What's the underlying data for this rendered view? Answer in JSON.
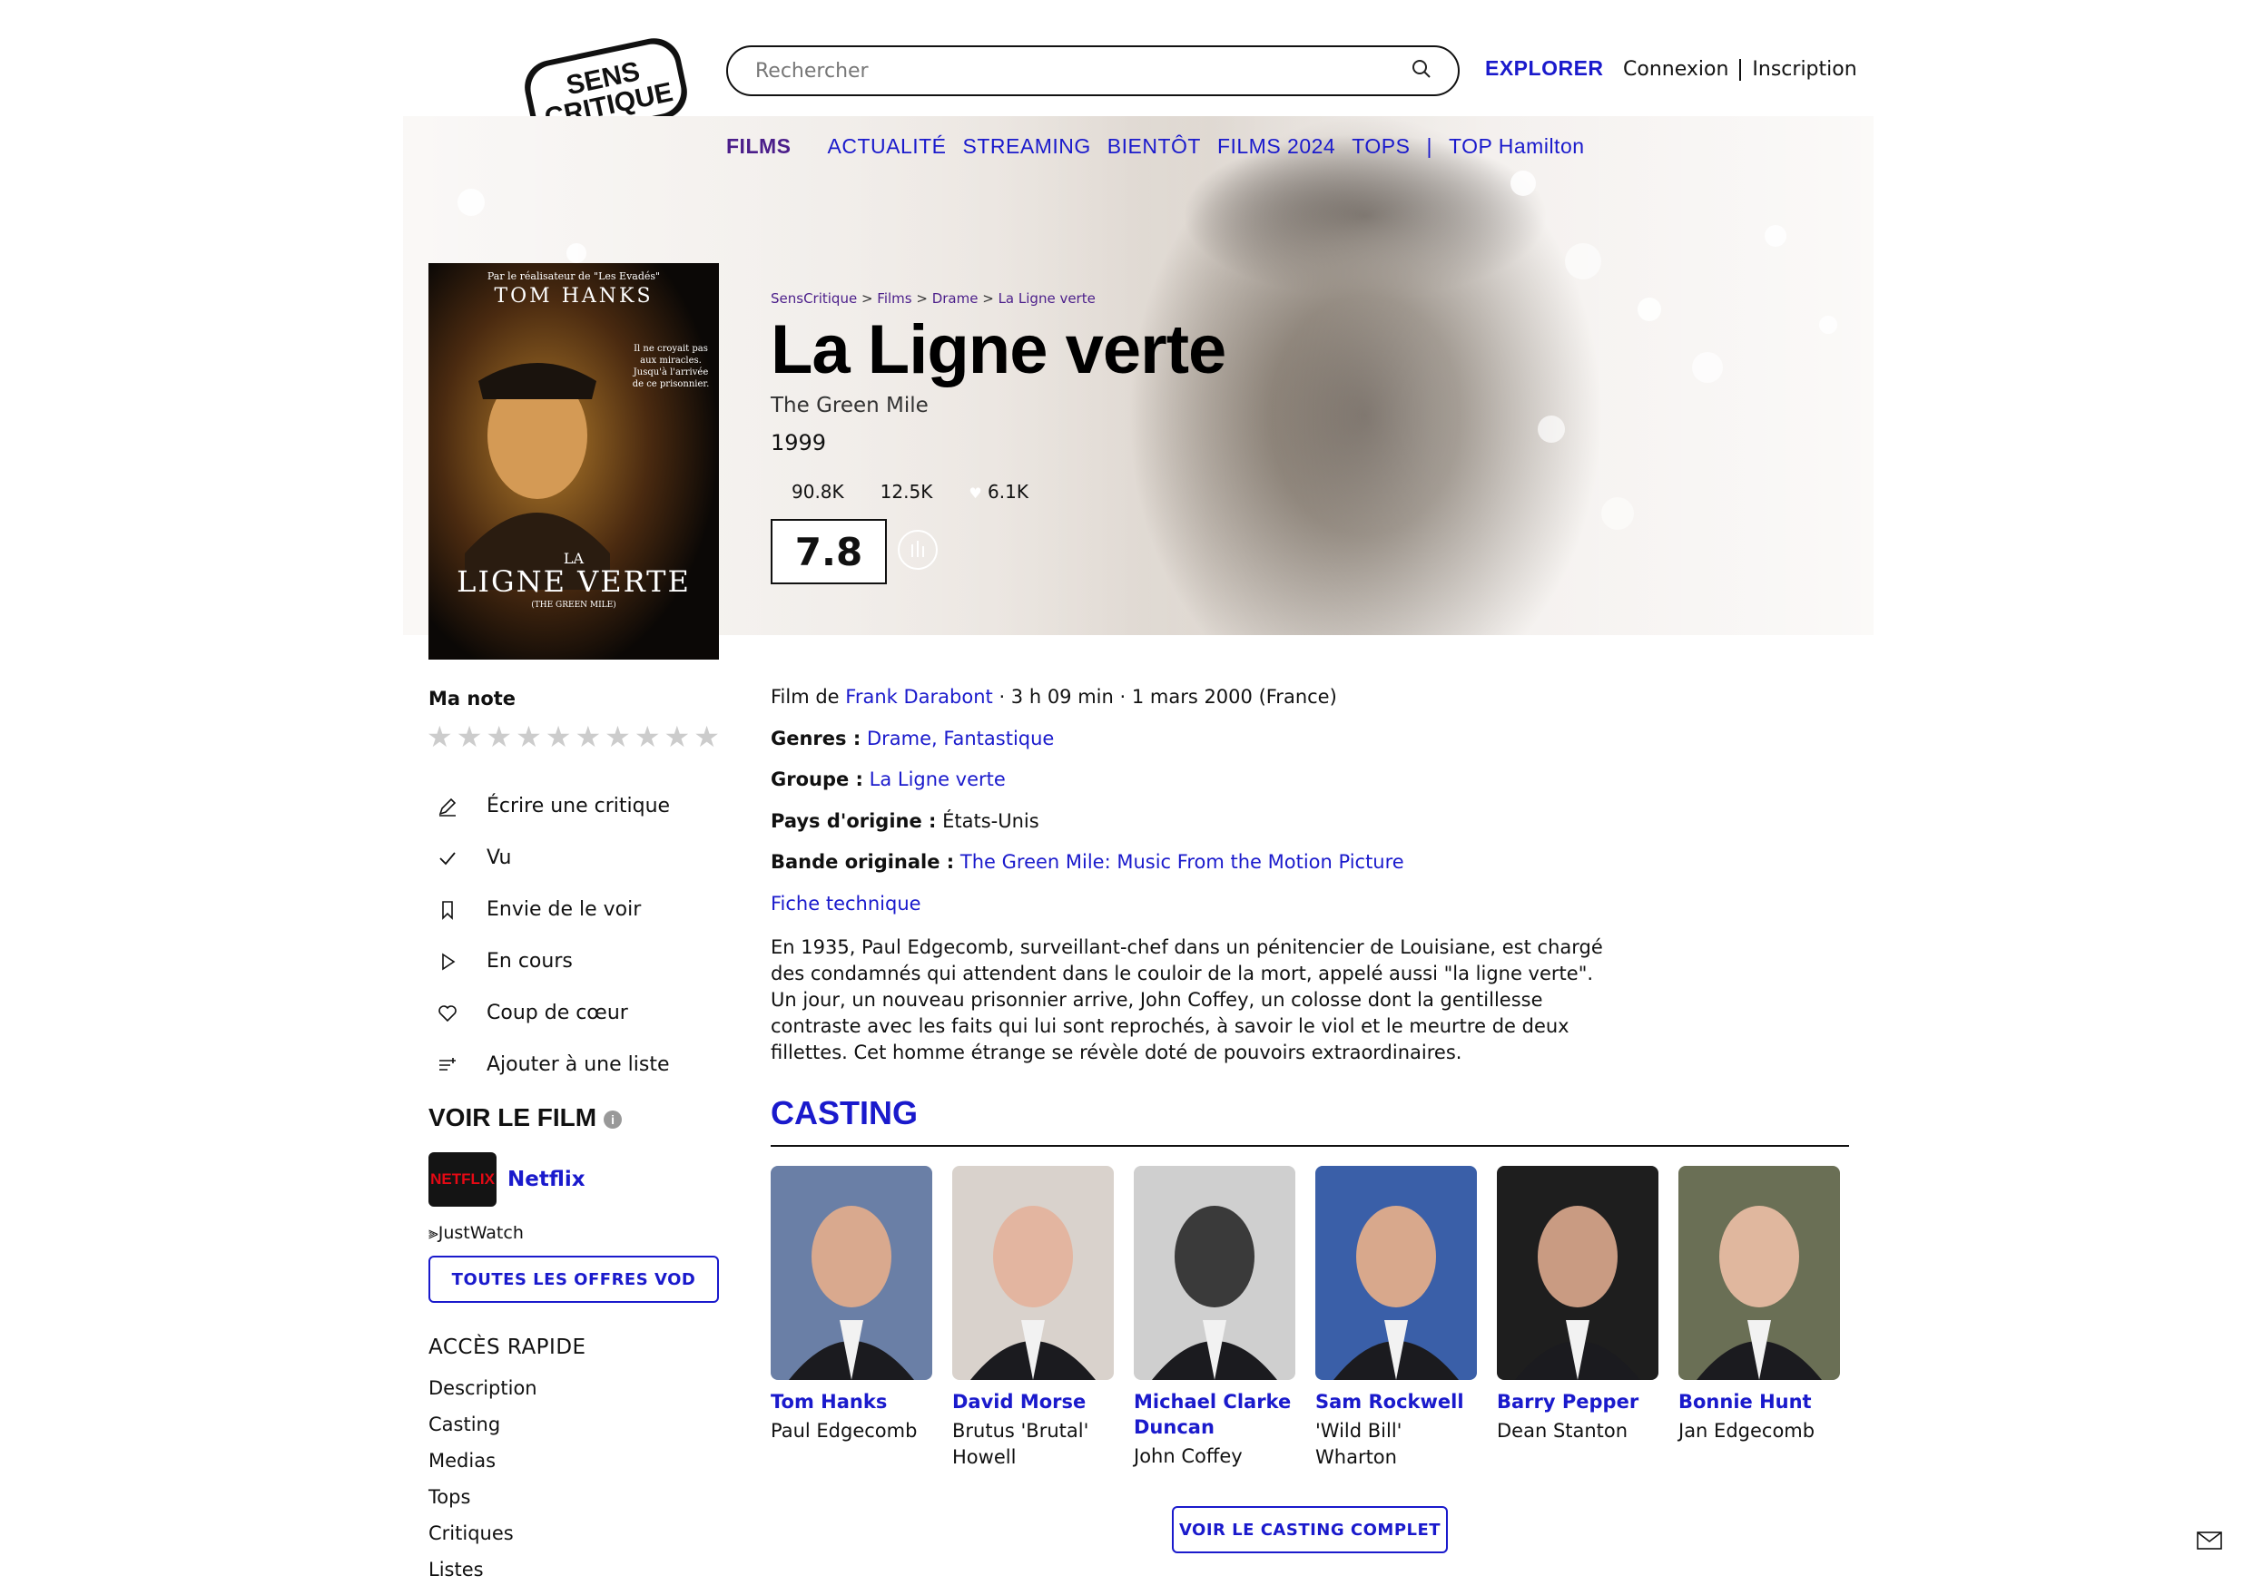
{
  "header": {
    "logo_text": "SENS CRITIQUE",
    "search_placeholder": "Rechercher",
    "explorer": "EXPLORER",
    "login": "Connexion",
    "signup": "Inscription"
  },
  "subnav": {
    "films": "FILMS",
    "items": [
      "ACTUALITÉ",
      "STREAMING",
      "BIENTÔT",
      "FILMS 2024",
      "TOPS"
    ],
    "top": "TOP Hamilton"
  },
  "poster": {
    "tagline": "Par le réalisateur de \"Les Evadés\"",
    "actor": "TOM HANKS",
    "quote": "Il ne croyait pas aux miracles. Jusqu'à l'arrivée de ce prisonnier.",
    "title_small": "LA",
    "title_big": "LIGNE VERTE",
    "title_en": "(THE GREEN MILE)"
  },
  "breadcrumb": [
    "SensCritique",
    "Films",
    "Drame",
    "La Ligne verte"
  ],
  "movie": {
    "title": "La Ligne verte",
    "original_title": "The Green Mile",
    "year": "1999",
    "stats": {
      "seen": "90.8K",
      "wish": "12.5K",
      "likes": "6.1K"
    },
    "rating": "7.8"
  },
  "left": {
    "ma_note": "Ma note",
    "actions": [
      "Écrire une critique",
      "Vu",
      "Envie de le voir",
      "En cours",
      "Coup de cœur",
      "Ajouter à une liste"
    ],
    "voir_le_film": "VOIR LE FILM",
    "provider": "Netflix",
    "provider_logo": "NETFLIX",
    "justwatch": "JustWatch",
    "vod_button": "TOUTES LES OFFRES VOD",
    "acces_rapide": "ACCÈS RAPIDE",
    "acces_links": [
      "Description",
      "Casting",
      "Medias",
      "Tops",
      "Critiques",
      "Listes"
    ]
  },
  "details": {
    "film_de": "Film de",
    "director": "Frank Darabont",
    "meta": " · 3 h 09 min · 1 mars 2000 (France)",
    "genres_label": "Genres :",
    "genres": "Drame, Fantastique",
    "groupe_label": "Groupe :",
    "groupe": "La Ligne verte",
    "pays_label": "Pays d'origine :",
    "pays": "États-Unis",
    "bo_label": "Bande originale :",
    "bo": "The Green Mile: Music From the Motion Picture",
    "fiche": "Fiche technique",
    "synopsis": "En 1935, Paul Edgecomb, surveillant-chef dans un pénitencier de Louisiane, est chargé des condamnés qui attendent dans le couloir de la mort, appelé aussi \"la ligne verte\". Un jour, un nouveau prisonnier arrive, John Coffey, un colosse dont la gentillesse contraste avec les faits qui lui sont reprochés, à savoir le viol et le meurtre de deux fillettes. Cet homme étrange se révèle doté de pouvoirs extraordinaires."
  },
  "casting": {
    "title": "CASTING",
    "actors": [
      {
        "name": "Tom Hanks",
        "role": "Paul Edgecomb",
        "bg": "#6a7fa6",
        "skin": "#d9a98e"
      },
      {
        "name": "David Morse",
        "role": "Brutus 'Brutal' Howell",
        "bg": "#d9d2cc",
        "skin": "#e3b5a0"
      },
      {
        "name": "Michael Clarke Duncan",
        "role": "John Coffey",
        "bg": "#cfcfcf",
        "skin": "#3a3a3a"
      },
      {
        "name": "Sam Rockwell",
        "role": "'Wild Bill' Wharton",
        "bg": "#3a5fa8",
        "skin": "#d8a88c"
      },
      {
        "name": "Barry Pepper",
        "role": "Dean Stanton",
        "bg": "#1e1e1e",
        "skin": "#c99b82"
      },
      {
        "name": "Bonnie Hunt",
        "role": "Jan Edgecomb",
        "bg": "#6a6f55",
        "skin": "#e0b79e"
      }
    ],
    "full_button": "VOIR LE CASTING COMPLET"
  },
  "colors": {
    "accent": "#1a1acc",
    "films_nav": "#4b1e8a",
    "netflix_red": "#e50914"
  }
}
